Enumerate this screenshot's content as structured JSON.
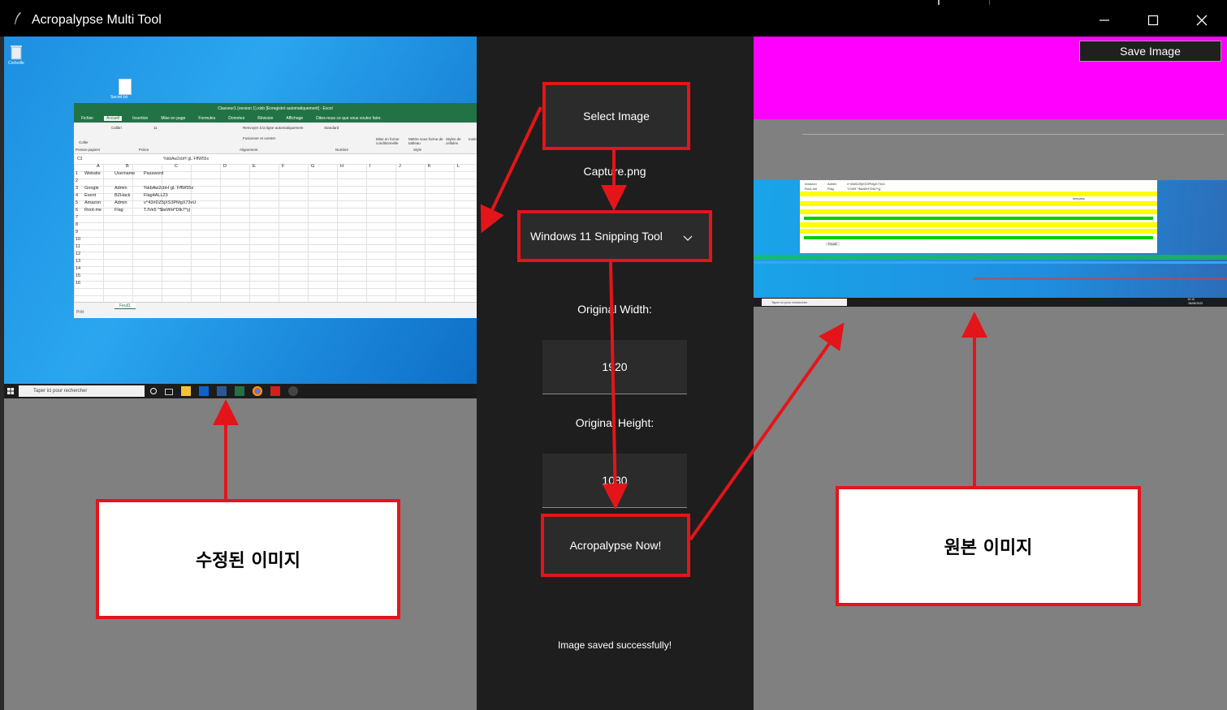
{
  "window": {
    "title": "Acropalypse Multi Tool",
    "controls": {
      "minimize": "minimize-icon",
      "maximize": "maximize-icon",
      "close": "close-icon"
    }
  },
  "left_image": {
    "desktop": {
      "recycle_label": "Corbeille",
      "doc_label": "Secret.txt"
    },
    "excel": {
      "title": "Classeur1 (version 1).xlsb [Enregistré automatiquement] - Excel",
      "tabs": [
        "Fichier",
        "Accueil",
        "Insertion",
        "Mise en page",
        "Formules",
        "Données",
        "Révision",
        "Affichage",
        "Dites-nous ce que vous voulez faire."
      ],
      "ribbon_text": [
        "Coller",
        "Calibri",
        "11",
        "Renvoyer à la ligne automatiquement",
        "Standard",
        "Fusionner et centrer",
        "Mise en forme conditionnelle",
        "Mettre sous forme de tableau",
        "Styles de cellules",
        "Insérer",
        "Presse-papiers",
        "Police",
        "Alignement",
        "Nombre",
        "Style"
      ],
      "namebox": "C3",
      "formula": "%kbAw2cbH`gL`FffW55x",
      "columns": [
        "A",
        "B",
        "C",
        "D",
        "E",
        "F",
        "G",
        "H",
        "I",
        "J",
        "K",
        "L"
      ],
      "rows": [
        [
          "Website",
          "Username",
          "Password"
        ],
        [
          "",
          "",
          ""
        ],
        [
          "Google",
          "Admin",
          "%kbAw2cbH`gL`FffW55x"
        ],
        [
          "Event",
          "BZHack",
          "Flag4ALL23"
        ],
        [
          "Amazon",
          "Admin",
          "v^43#DZ5jXS3PMgX73vU"
        ],
        [
          "Root-me",
          "Flag",
          "TJVe5`^$iwWH*Dtk7*yj"
        ]
      ],
      "row_numbers": [
        "1",
        "2",
        "3",
        "4",
        "5",
        "6",
        "7",
        "8",
        "9",
        "10",
        "11",
        "12",
        "13",
        "14",
        "15",
        "16"
      ],
      "sheet_tab": "Feuil1",
      "status": "Prêt"
    },
    "taskbar_search": "Taper ici pour rechercher"
  },
  "controls_panel": {
    "select_image_label": "Select Image",
    "file_name": "Capture.png",
    "tool_select": "Windows 11 Snipping Tool",
    "original_width_label": "Original Width:",
    "original_width_value": "1920",
    "original_height_label": "Original Height:",
    "original_height_value": "1080",
    "run_label": "Acropalypse Now!",
    "status_message": "Image saved successfully!"
  },
  "right_image": {
    "save_label": "Save Image",
    "glitch_text": [
      "Amazon",
      "Admin",
      "v^43#DZ5jXS3PMgX73vU",
      "Root-me",
      "Flag",
      "TJVe5`^$iwWH*Dtk7*yj",
      "keepass",
      "Feuil1"
    ],
    "taskbar_search": "Taper ici pour rechercher",
    "clock": [
      "10:10",
      "06/06/2023"
    ]
  },
  "annotations": {
    "modified": "수정된 이미지",
    "original": "원본 이미지"
  },
  "colors": {
    "accent_red": "#e3151a",
    "magenta": "#ff00ff",
    "panel": "#1e1e1e",
    "pane_gray": "#808080"
  }
}
